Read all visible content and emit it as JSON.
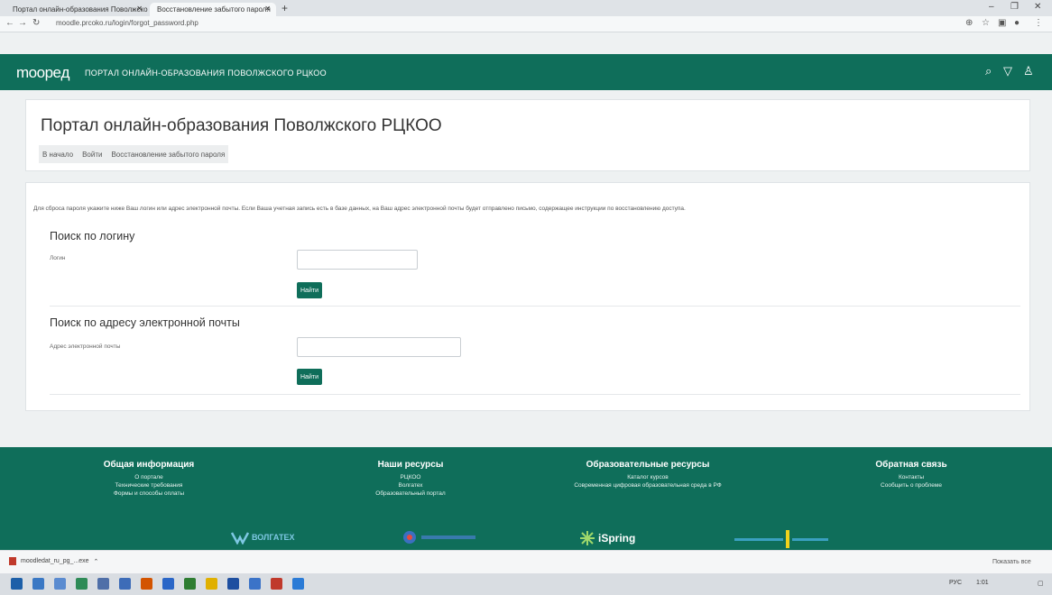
{
  "browser": {
    "tabs": [
      {
        "label": "Портал онлайн-образования Поволжского РЦКОО"
      },
      {
        "label": "Восстановление забытого пароля"
      }
    ],
    "new_tab": "+",
    "url": "moodle.prcoko.ru/login/forgot_password.php",
    "window_controls": [
      "–",
      "❐",
      "✕"
    ]
  },
  "site": {
    "logo": "moopeд",
    "portal_name": "ПОРТАЛ ОНЛАЙН-ОБРАЗОВАНИЯ ПОВОЛЖСКОГО РЦКОО",
    "header_icons": [
      "search-icon",
      "filter-icon",
      "user-icon"
    ]
  },
  "page_header": {
    "title": "Портал онлайн-образования Поволжского РЦКОО",
    "breadcrumb": [
      "В начало",
      "Войти",
      "Восстановление забытого пароля"
    ]
  },
  "main": {
    "instructions": "Для сброса пароля укажите ниже Ваш логин или адрес электронной почты. Если Ваша учетная запись есть в базе данных, на Ваш адрес электронной почты будет отправлено письмо, содержащее инструкции по восстановлению доступа.",
    "login_section": {
      "title": "Поиск по логину",
      "label": "Логин",
      "value": "",
      "button": "Найти"
    },
    "email_section": {
      "title": "Поиск по адресу электронной почты",
      "label": "Адрес электронной почты",
      "value": "",
      "button": "Найти"
    }
  },
  "footer": {
    "columns": [
      {
        "title": "Общая информация",
        "links": [
          "О портале",
          "Технические требования",
          "Формы и способы оплаты"
        ]
      },
      {
        "title": "Наши ресурсы",
        "links": [
          "РЦКОО",
          "Волгатех",
          "Образовательный портал"
        ]
      },
      {
        "title": "Образовательные ресурсы",
        "links": [
          "Каталог курсов",
          "Современная цифровая образовательная среда в РФ"
        ]
      },
      {
        "title": "Обратная связь",
        "links": [
          "Контакты",
          "Сообщить о проблеме"
        ]
      }
    ],
    "partners": [
      "ВОЛГАТЕХ",
      "iSpring"
    ]
  },
  "download": {
    "file": "moodledat_ru_pg_...exe",
    "show_all": "Показать все"
  },
  "taskbar": {
    "lang": "РУС",
    "time": "1:01"
  },
  "colors": {
    "brand": "#0f6e5a"
  }
}
